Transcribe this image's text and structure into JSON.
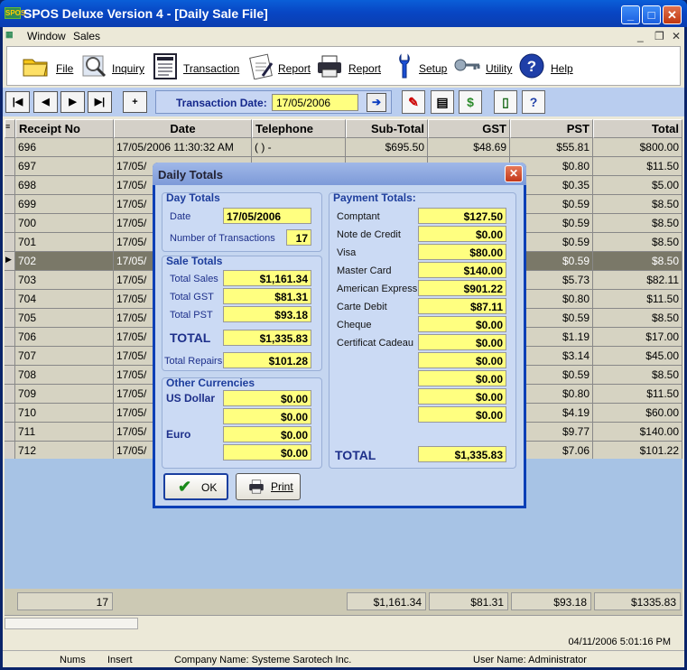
{
  "window": {
    "title": "SPOS Deluxe Version 4 - [Daily Sale File]",
    "app_icon_text": "SPOS"
  },
  "menu": {
    "items": [
      "Window",
      "Sales"
    ]
  },
  "toolbar": {
    "file": "File",
    "inquiry": "Inquiry",
    "transaction": "Transaction",
    "report1": "Report",
    "report2": "Report",
    "setup": "Setup",
    "utility": "Utility",
    "help": "Help"
  },
  "navbar": {
    "transaction_date_label": "Transaction Date:",
    "transaction_date": "17/05/2006"
  },
  "grid": {
    "columns": [
      "Receipt No",
      "Date",
      "Telephone",
      "Sub-Total",
      "GST",
      "PST",
      "Total"
    ],
    "rows": [
      {
        "receipt": "696",
        "date": "17/05/2006 11:30:32 AM",
        "tel": "(  )    -",
        "sub": "$695.50",
        "gst": "$48.69",
        "pst": "$55.81",
        "total": "$800.00"
      },
      {
        "receipt": "697",
        "date": "17/05/",
        "tel": "",
        "sub": "",
        "gst": "",
        "pst": "$0.80",
        "total": "$11.50"
      },
      {
        "receipt": "698",
        "date": "17/05/",
        "tel": "",
        "sub": "",
        "gst": "",
        "pst": "$0.35",
        "total": "$5.00"
      },
      {
        "receipt": "699",
        "date": "17/05/",
        "tel": "",
        "sub": "",
        "gst": "",
        "pst": "$0.59",
        "total": "$8.50"
      },
      {
        "receipt": "700",
        "date": "17/05/",
        "tel": "",
        "sub": "",
        "gst": "",
        "pst": "$0.59",
        "total": "$8.50"
      },
      {
        "receipt": "701",
        "date": "17/05/",
        "tel": "",
        "sub": "",
        "gst": "",
        "pst": "$0.59",
        "total": "$8.50"
      },
      {
        "receipt": "702",
        "date": "17/05/",
        "tel": "",
        "sub": "",
        "gst": "",
        "pst": "$0.59",
        "total": "$8.50"
      },
      {
        "receipt": "703",
        "date": "17/05/",
        "tel": "",
        "sub": "",
        "gst": "",
        "pst": "$5.73",
        "total": "$82.11"
      },
      {
        "receipt": "704",
        "date": "17/05/",
        "tel": "",
        "sub": "",
        "gst": "",
        "pst": "$0.80",
        "total": "$11.50"
      },
      {
        "receipt": "705",
        "date": "17/05/",
        "tel": "",
        "sub": "",
        "gst": "",
        "pst": "$0.59",
        "total": "$8.50"
      },
      {
        "receipt": "706",
        "date": "17/05/",
        "tel": "",
        "sub": "",
        "gst": "",
        "pst": "$1.19",
        "total": "$17.00"
      },
      {
        "receipt": "707",
        "date": "17/05/",
        "tel": "",
        "sub": "",
        "gst": "",
        "pst": "$3.14",
        "total": "$45.00"
      },
      {
        "receipt": "708",
        "date": "17/05/",
        "tel": "",
        "sub": "",
        "gst": "",
        "pst": "$0.59",
        "total": "$8.50"
      },
      {
        "receipt": "709",
        "date": "17/05/",
        "tel": "",
        "sub": "",
        "gst": "",
        "pst": "$0.80",
        "total": "$11.50"
      },
      {
        "receipt": "710",
        "date": "17/05/",
        "tel": "",
        "sub": "",
        "gst": "",
        "pst": "$4.19",
        "total": "$60.00"
      },
      {
        "receipt": "711",
        "date": "17/05/",
        "tel": "",
        "sub": "",
        "gst": "",
        "pst": "$9.77",
        "total": "$140.00"
      },
      {
        "receipt": "712",
        "date": "17/05/",
        "tel": "",
        "sub": "",
        "gst": "",
        "pst": "$7.06",
        "total": "$101.22"
      }
    ],
    "selected_receipt": "702"
  },
  "totals_row": {
    "count": "17",
    "sub": "$1,161.34",
    "gst": "$81.31",
    "pst": "$93.18",
    "total": "$1335.83"
  },
  "datetime": "04/11/2006 5:01:16 PM",
  "status": {
    "nums": "Nums",
    "insert": "Insert",
    "company": "Company Name: Systeme Sarotech Inc.",
    "user": "User Name: Administrator"
  },
  "dialog": {
    "title": "Daily Totals",
    "day_totals": {
      "title": "Day Totals",
      "date_label": "Date",
      "date": "17/05/2006",
      "num_label": "Number of Transactions",
      "num": "17"
    },
    "sale_totals": {
      "title": "Sale Totals",
      "sales_label": "Total Sales",
      "sales": "$1,161.34",
      "gst_label": "Total GST",
      "gst": "$81.31",
      "pst_label": "Total PST",
      "pst": "$93.18",
      "total_label": "TOTAL",
      "total": "$1,335.83",
      "repairs_label": "Total Repairs",
      "repairs": "$101.28"
    },
    "other_currencies": {
      "title": "Other Currencies",
      "usd_label": "US Dollar",
      "usd1": "$0.00",
      "usd2": "$0.00",
      "euro_label": "Euro",
      "euro1": "$0.00",
      "euro2": "$0.00"
    },
    "payment_totals": {
      "title": "Payment Totals:",
      "items": [
        {
          "label": "Comptant",
          "value": "$127.50"
        },
        {
          "label": "Note de Credit",
          "value": "$0.00"
        },
        {
          "label": "Visa",
          "value": "$80.00"
        },
        {
          "label": "Master Card",
          "value": "$140.00"
        },
        {
          "label": "American Express",
          "value": "$901.22"
        },
        {
          "label": "Carte Debit",
          "value": "$87.11"
        },
        {
          "label": "Cheque",
          "value": "$0.00"
        },
        {
          "label": "Certificat Cadeau",
          "value": "$0.00"
        },
        {
          "label": "",
          "value": "$0.00"
        },
        {
          "label": "",
          "value": "$0.00"
        },
        {
          "label": "",
          "value": "$0.00"
        },
        {
          "label": "",
          "value": "$0.00"
        }
      ],
      "total_label": "TOTAL",
      "total": "$1,335.83"
    },
    "ok": "OK",
    "print": "Print"
  }
}
